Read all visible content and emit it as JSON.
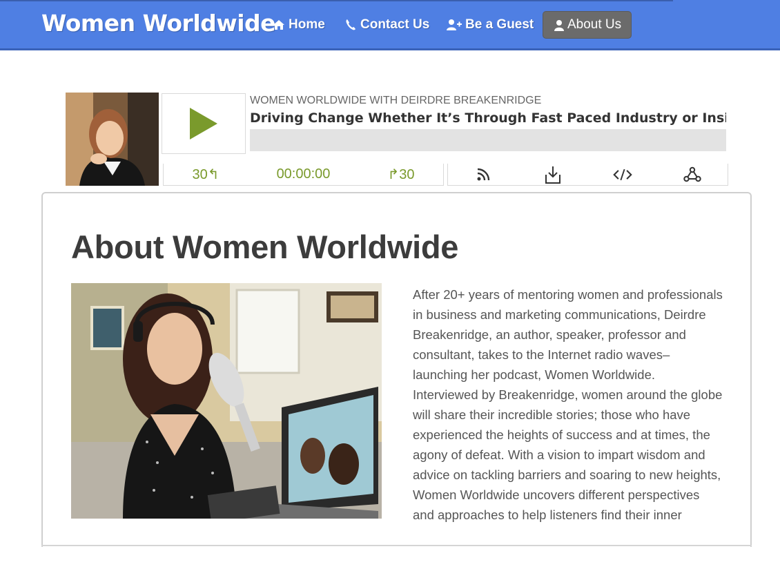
{
  "nav": {
    "brand": "Women Worldwide",
    "items": [
      {
        "label": "Home",
        "icon": "home-icon"
      },
      {
        "label": "Contact Us",
        "icon": "phone-icon"
      },
      {
        "label": "Be a Guest",
        "icon": "user-plus-icon"
      },
      {
        "label": "About Us",
        "icon": "user-icon",
        "active": true
      }
    ]
  },
  "player": {
    "show_name": "WOMEN WORLDWIDE WITH DEIRDRE BREAKENRIDGE",
    "episode_title": "Driving Change Whether It’s Through Fast Paced Industry or Insid...",
    "rewind_label": "30↰",
    "time": "00:00:00",
    "forward_label": "↱30",
    "progress": 0,
    "accent_color": "#7a9a2c"
  },
  "content": {
    "heading": "About Women Worldwide",
    "paragraph": "After 20+ years of mentoring women and professionals in business and marketing communications, Deirdre Breakenridge, an author, speaker, professor and consultant, takes to the Internet radio waves–launching her podcast, Women Worldwide. Interviewed by Breakenridge, women around the globe will share their incredible stories; those who have experienced the heights of success and at times, the agony of defeat. With a vision to impart wisdom and advice on tackling barriers and soaring to new heights, Women Worldwide uncovers different perspectives and approaches to help listeners find their inner"
  },
  "colors": {
    "navbar": "#4f7fe3",
    "active_tab": "#6b6b6b"
  }
}
